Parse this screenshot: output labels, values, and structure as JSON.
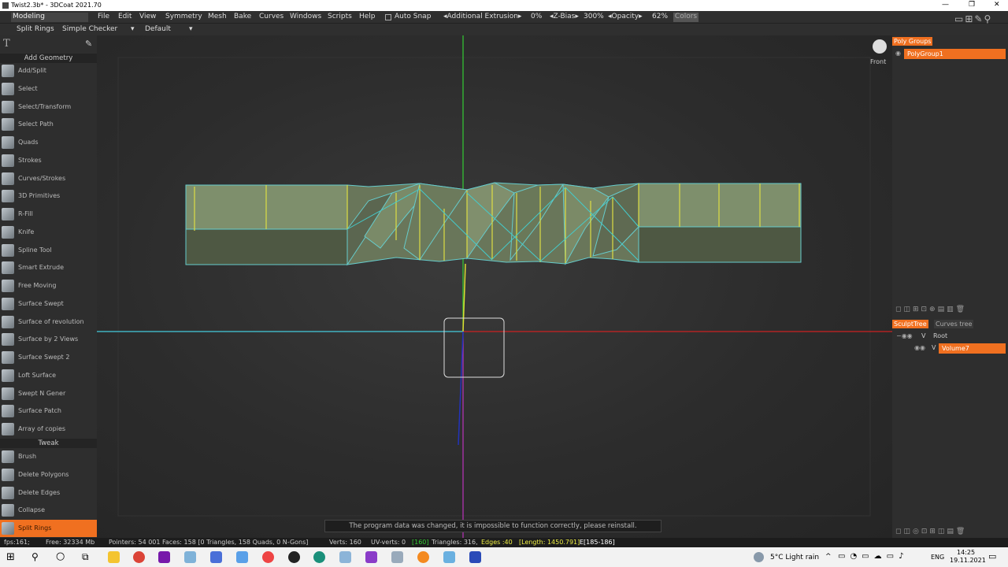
{
  "window": {
    "title": "Twist2.3b* - 3DCoat 2021.70",
    "controls": [
      "—",
      "❐",
      "✕"
    ]
  },
  "menubar": {
    "mode": "Modeling",
    "items": [
      "File",
      "Edit",
      "View",
      "Symmetry",
      "Mesh",
      "Bake",
      "Curves",
      "Windows",
      "Scripts",
      "Help"
    ],
    "auto_snap": "Auto Snap",
    "additional_extrusion": "◂Additional Extrusion▸",
    "extrusion_value": "0%",
    "zbias_label": "◂Z-Bias▸",
    "zbias_value": "300%",
    "opacity_label": "◂Opacity▸",
    "opacity_value": "62%",
    "colors": "Colors"
  },
  "toolbar2": {
    "tool": "Split Rings",
    "mode": "Simple Checker",
    "mode_arrow": "▾",
    "preset": "Default",
    "preset_arrow": "▾"
  },
  "sidebar": {
    "add_geometry_title": "Add Geometry",
    "add_geometry_tools": [
      "Add/Split",
      "Select",
      "Select/Transform",
      "Select Path",
      "Quads",
      "Strokes",
      "Curves/Strokes",
      "3D Primitives",
      "R-Fill",
      "Knife",
      "Spline Tool",
      "Smart Extrude",
      "Free Moving",
      "Surface Swept",
      "Surface of revolution",
      "Surface by 2 Views",
      "Surface Swept 2",
      "Loft Surface",
      "Swept N Gener",
      "Surface Patch",
      "Array of copies"
    ],
    "tweak_title": "Tweak",
    "tweak_tools": [
      "Brush",
      "Delete Polygons",
      "Delete Edges",
      "Collapse",
      "Split Rings"
    ],
    "active_tool": "Split Rings"
  },
  "viewport": {
    "view_label": "Front",
    "message": "The program data was changed, it is impossible to function correctly, please reinstall."
  },
  "right_panel": {
    "polygroups_tab": "Poly Groups",
    "polygroup_items": [
      "PolyGroup1"
    ],
    "sculpt_tree_tab": "SculptTree",
    "curves_tree_tab": "Curves tree",
    "tree_root": "Root",
    "tree_items": [
      "Volume7"
    ],
    "tree_v": "V"
  },
  "status": {
    "fps": "fps:161;",
    "free": "Free: 32334 Mb",
    "points": "Pointers: 54 001 Faces: 158 [0 Triangles, 158 Quads, 0 N-Gons]",
    "verts": "Verts: 160",
    "uv_verts": "UV-verts: 0",
    "uv_verts_bracket": "[160]",
    "triangles": "Triangles: 316,",
    "edges": "Edges :40",
    "length": "[Length: 1450.791]",
    "edge_range": "E[185-186]"
  },
  "taskbar": {
    "weather": "5°C Light rain",
    "lang": "ENG",
    "time": "14:25",
    "date": "19.11.2021",
    "chevron": "^"
  },
  "colors": {
    "accent": "#f07020",
    "panel": "#2e2e2e",
    "viewport": "#2c2c2c"
  }
}
